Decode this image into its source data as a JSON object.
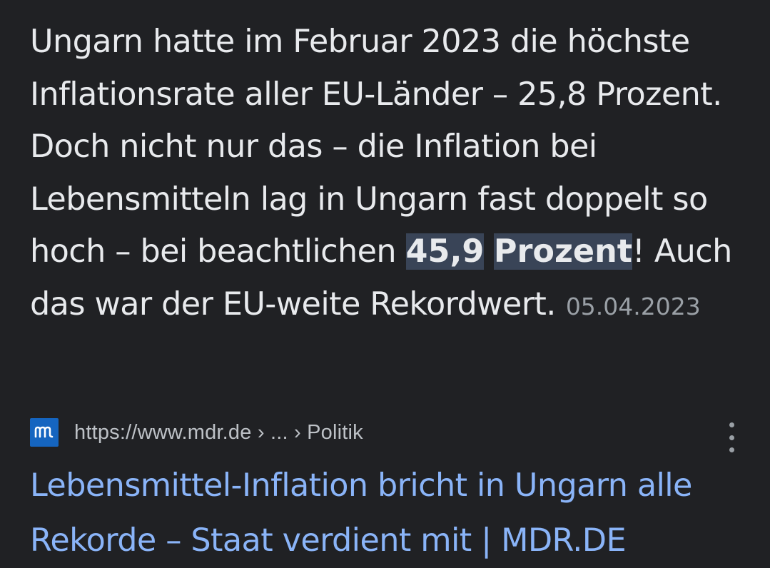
{
  "snippet": {
    "text_before": "Ungarn hatte im Februar 2023 die höchste Inflationsrate aller EU-Länder – 25,8 Prozent. Doch nicht nur das – die Inflation bei Lebensmitteln lag in Ungarn fast doppelt so hoch – bei beachtlichen ",
    "highlight_1": "45,9",
    "highlight_2": "Prozent",
    "text_after": "! Auch das war der EU-weite Rekordwert.",
    "date": "05.04.2023"
  },
  "result": {
    "favicon_icon": "mdr-logo-icon",
    "favicon_color": "#1565c0",
    "url": "https://www.mdr.de › ... › Politik",
    "title": "Lebensmittel-Inflation bricht in Ungarn alle Rekorde – Staat verdient mit | MDR.DE",
    "menu_icon": "more-vert-icon",
    "link_color": "#8ab4f8"
  }
}
